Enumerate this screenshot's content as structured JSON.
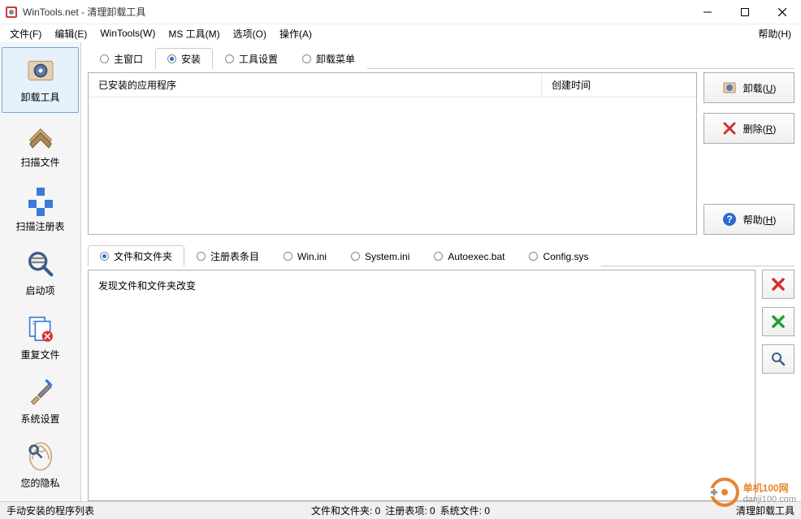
{
  "window": {
    "title": "WinTools.net - 清理卸载工具"
  },
  "menubar": {
    "file": "文件(F)",
    "edit": "编辑(E)",
    "wintools": "WinTools(W)",
    "mstools": "MS 工具(M)",
    "options": "选项(O)",
    "operations": "操作(A)",
    "help": "帮助(H)"
  },
  "sidebar": {
    "items": [
      {
        "label": "卸载工具"
      },
      {
        "label": "扫描文件"
      },
      {
        "label": "扫描注册表"
      },
      {
        "label": "启动项"
      },
      {
        "label": "重复文件"
      },
      {
        "label": "系统设置"
      },
      {
        "label": "您的隐私"
      }
    ]
  },
  "tabs_upper": {
    "main_window": "主窗口",
    "install": "安装",
    "tool_settings": "工具设置",
    "uninstall_menu": "卸载菜单"
  },
  "list": {
    "col_app": "已安装的应用程序",
    "col_time": "创建时间"
  },
  "buttons": {
    "uninstall": "卸载(U)",
    "delete": "删除(R)",
    "help": "帮助(H)"
  },
  "tabs_lower": {
    "files_folders": "文件和文件夹",
    "registry_entries": "注册表条目",
    "winini": "Win.ini",
    "systemini": "System.ini",
    "autoexec": "Autoexec.bat",
    "config": "Config.sys"
  },
  "changes": {
    "title": "发现文件和文件夹改变"
  },
  "status": {
    "left": "手动安装的程序列表",
    "files_folders": "文件和文件夹: 0",
    "registry": "注册表项: 0",
    "system_files": "系统文件: 0",
    "right": "清理卸载工具"
  },
  "watermark": {
    "line1": "单机100网",
    "line2": "danji100.com"
  }
}
